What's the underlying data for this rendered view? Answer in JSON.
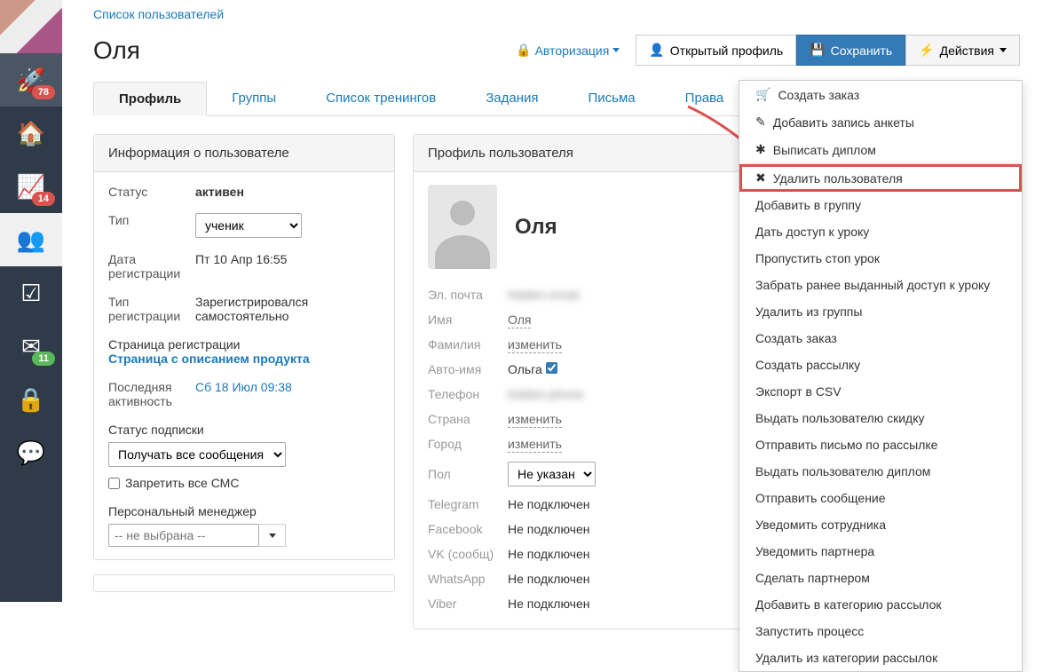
{
  "breadcrumb": "Список пользователей",
  "page_title": "Оля",
  "header": {
    "auth": "Авторизация",
    "open_profile": "Открытый профиль",
    "save": "Сохранить",
    "actions": "Действия"
  },
  "nav_badges": {
    "rocket": "78",
    "chart": "14",
    "mail": "11"
  },
  "tabs": [
    "Профиль",
    "Группы",
    "Список тренингов",
    "Задания",
    "Письма",
    "Права"
  ],
  "active_tab": 0,
  "info": {
    "title": "Информация о пользователе",
    "status_lbl": "Статус",
    "status": "активен",
    "type_lbl": "Тип",
    "type_options": [
      "ученик"
    ],
    "type_selected": "ученик",
    "reg_date_lbl": "Дата регистрации",
    "reg_date": "Пт 10 Апр 16:55",
    "reg_type_lbl": "Тип регистрации",
    "reg_type": "Зарегистрировался самостоятельно",
    "reg_page_lbl": "Страница регистрации",
    "reg_page_link": "Страница с описанием продукта",
    "last_act_lbl": "Последняя активность",
    "last_act": "Сб 18 Июл 09:38",
    "sub_status_lbl": "Статус подписки",
    "sub_options": [
      "Получать все сообщения"
    ],
    "sub_selected": "Получать все сообщения",
    "no_sms": "Запретить все СМС",
    "manager_lbl": "Персональный менеджер",
    "manager_placeholder": "-- не выбрана --"
  },
  "profile": {
    "title": "Профиль пользователя",
    "name": "Оля",
    "rows": {
      "email_lbl": "Эл. почта",
      "email": "hidden-email",
      "fname_lbl": "Имя",
      "fname": "Оля",
      "lname_lbl": "Фамилия",
      "lname": "изменить",
      "autoname_lbl": "Авто-имя",
      "autoname": "Ольга",
      "autoname_checked": true,
      "phone_lbl": "Телефон",
      "phone": "hidden-phone",
      "country_lbl": "Страна",
      "country": "изменить",
      "city_lbl": "Город",
      "city": "изменить",
      "gender_lbl": "Пол",
      "gender_options": [
        "Не указан"
      ],
      "gender_selected": "Не указан",
      "tg_lbl": "Telegram",
      "tg": "Не подключен",
      "fb_lbl": "Facebook",
      "fb": "Не подключен",
      "vk_lbl": "VK (сообщ)",
      "vk": "Не подключен",
      "wa_lbl": "WhatsApp",
      "wa": "Не подключен",
      "viber_lbl": "Viber",
      "viber": "Не подключен"
    }
  },
  "menu": [
    {
      "icon": "🛒",
      "label": "Создать заказ"
    },
    {
      "icon": "✎",
      "label": "Добавить запись анкеты"
    },
    {
      "icon": "✱",
      "label": "Выписать диплом"
    },
    {
      "divider": true
    },
    {
      "icon": "✖",
      "label": "Удалить пользователя",
      "highlight": true
    },
    {
      "label": "Добавить в группу"
    },
    {
      "label": "Дать доступ к уроку"
    },
    {
      "label": "Пропустить стоп урок"
    },
    {
      "label": "Забрать ранее выданный доступ к уроку"
    },
    {
      "label": "Удалить из группы"
    },
    {
      "label": "Создать заказ"
    },
    {
      "label": "Создать рассылку"
    },
    {
      "label": "Экспорт в CSV"
    },
    {
      "label": "Выдать пользователю скидку"
    },
    {
      "label": "Отправить письмо по рассылке"
    },
    {
      "label": "Выдать пользователю диплом"
    },
    {
      "label": "Отправить сообщение"
    },
    {
      "label": "Уведомить сотрудника"
    },
    {
      "label": "Уведомить партнера"
    },
    {
      "label": "Сделать партнером"
    },
    {
      "label": "Добавить в категорию рассылок"
    },
    {
      "label": "Запустить процесс"
    },
    {
      "label": "Удалить из категории рассылок"
    }
  ]
}
